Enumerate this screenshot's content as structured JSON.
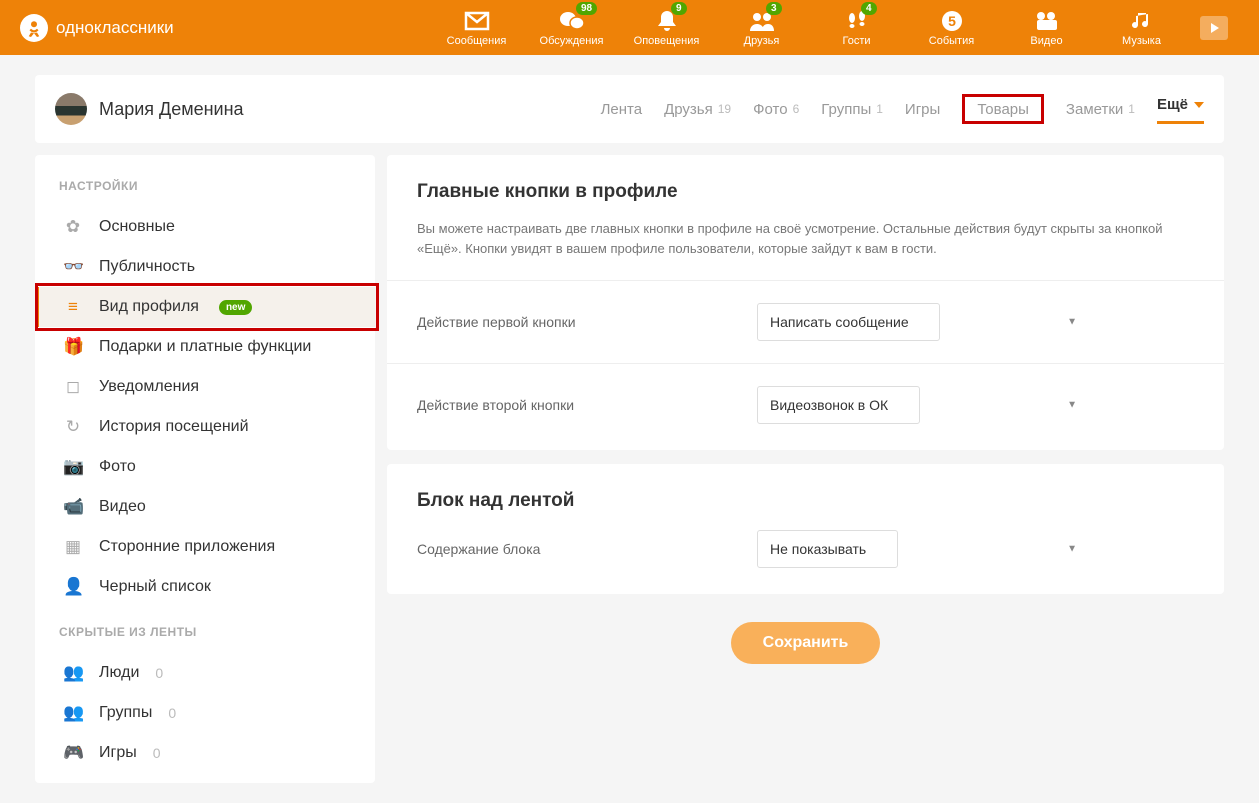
{
  "header": {
    "brand": "одноклассники",
    "nav": [
      {
        "label": "Сообщения",
        "badge": null,
        "icon": "envelope"
      },
      {
        "label": "Обсуждения",
        "badge": "98",
        "icon": "chat"
      },
      {
        "label": "Оповещения",
        "badge": "9",
        "icon": "bell"
      },
      {
        "label": "Друзья",
        "badge": "3",
        "icon": "friends"
      },
      {
        "label": "Гости",
        "badge": "4",
        "icon": "footprints"
      },
      {
        "label": "События",
        "badge": null,
        "icon": "coin"
      },
      {
        "label": "Видео",
        "badge": null,
        "icon": "video"
      },
      {
        "label": "Музыка",
        "badge": null,
        "icon": "music"
      }
    ]
  },
  "profile": {
    "name": "Мария Деменина",
    "tabs": [
      {
        "label": "Лента",
        "count": ""
      },
      {
        "label": "Друзья",
        "count": "19"
      },
      {
        "label": "Фото",
        "count": "6"
      },
      {
        "label": "Группы",
        "count": "1"
      },
      {
        "label": "Игры",
        "count": ""
      },
      {
        "label": "Товары",
        "count": "",
        "highlight": true
      },
      {
        "label": "Заметки",
        "count": "1"
      }
    ],
    "more": "Ещё"
  },
  "sidebar": {
    "title1": "НАСТРОЙКИ",
    "title2": "СКРЫТЫЕ ИЗ ЛЕНТЫ",
    "items1": [
      {
        "label": "Основные",
        "icon": "gear"
      },
      {
        "label": "Публичность",
        "icon": "eye"
      },
      {
        "label": "Вид профиля",
        "icon": "layout",
        "active": true,
        "new": "new"
      },
      {
        "label": "Подарки и платные функции",
        "icon": "gift"
      },
      {
        "label": "Уведомления",
        "icon": "bell2"
      },
      {
        "label": "История посещений",
        "icon": "history"
      },
      {
        "label": "Фото",
        "icon": "camera"
      },
      {
        "label": "Видео",
        "icon": "vcam"
      },
      {
        "label": "Сторонние приложения",
        "icon": "apps"
      },
      {
        "label": "Черный список",
        "icon": "block"
      }
    ],
    "items2": [
      {
        "label": "Люди",
        "count": "0",
        "icon": "people"
      },
      {
        "label": "Группы",
        "count": "0",
        "icon": "people"
      },
      {
        "label": "Игры",
        "count": "0",
        "icon": "game"
      }
    ]
  },
  "content": {
    "panel1": {
      "title": "Главные кнопки в профиле",
      "desc": "Вы можете настраивать две главных кнопки в профиле на своё усмотрение. Остальные действия будут скрыты за кнопкой «Ещё». Кнопки увидят в вашем профиле пользователи, которые зайдут к вам в гости.",
      "row1_label": "Действие первой кнопки",
      "row1_value": "Написать сообщение",
      "row2_label": "Действие второй кнопки",
      "row2_value": "Видеозвонок в ОК"
    },
    "panel2": {
      "title": "Блок над лентой",
      "row1_label": "Содержание блока",
      "row1_value": "Не показывать"
    },
    "save": "Сохранить"
  }
}
